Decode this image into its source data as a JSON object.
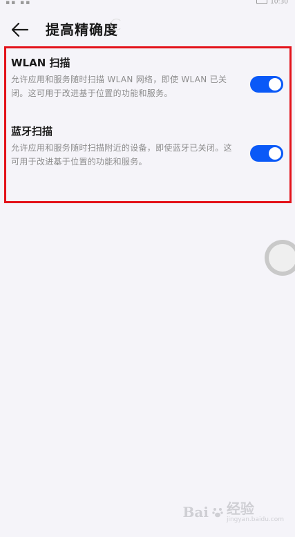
{
  "status_bar": {
    "time": "10:30"
  },
  "header": {
    "title": "提高精确度",
    "back_icon": "arrow-left-icon"
  },
  "settings": [
    {
      "title": "WLAN 扫描",
      "description": "允许应用和服务随时扫描 WLAN 网络，即使 WLAN 已关闭。这可用于改进基于位置的功能和服务。",
      "enabled": true
    },
    {
      "title": "蓝牙扫描",
      "description": "允许应用和服务随时扫描附近的设备，即使蓝牙已关闭。这可用于改进基于位置的功能和服务。",
      "enabled": true
    }
  ],
  "watermark": {
    "brand": "Bai",
    "suffix": "经验",
    "sub": "jingyan.baidu.com"
  },
  "colors": {
    "toggle_on": "#0a59f7",
    "highlight": "#e3121a",
    "background": "#f5f4f9"
  }
}
